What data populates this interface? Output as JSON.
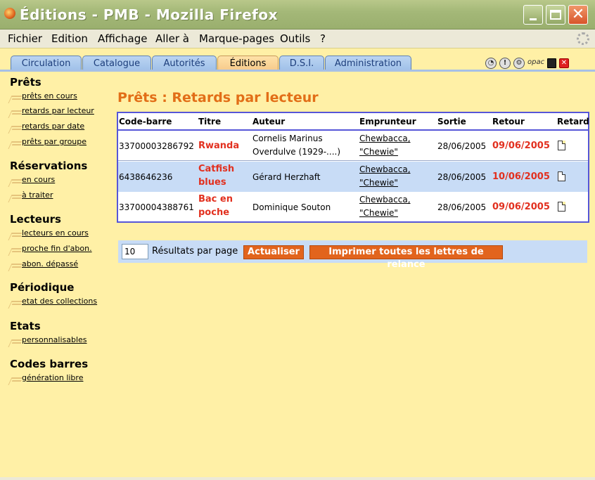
{
  "window": {
    "title": "Éditions - PMB - Mozilla Firefox"
  },
  "menubar": {
    "items": [
      {
        "label": "Fichier"
      },
      {
        "label": "Edition"
      },
      {
        "label": "Affichage"
      },
      {
        "label": "Aller à"
      },
      {
        "label": "Marque-pages"
      },
      {
        "label": "Outils"
      },
      {
        "label": "?"
      }
    ]
  },
  "tabs": [
    {
      "label": "Circulation"
    },
    {
      "label": "Catalogue"
    },
    {
      "label": "Autorités"
    },
    {
      "label": "Éditions",
      "active": true
    },
    {
      "label": "D.S.I."
    },
    {
      "label": "Administration"
    }
  ],
  "tab_icons": {
    "opac": "opac"
  },
  "sidebar": {
    "sections": [
      {
        "title": "Prêts",
        "links": [
          "prêts en cours",
          "retards par lecteur",
          "retards par date",
          "prêts par groupe"
        ]
      },
      {
        "title": "Réservations",
        "links": [
          "en cours",
          "à traiter"
        ]
      },
      {
        "title": "Lecteurs",
        "links": [
          "lecteurs en cours",
          "proche fin d'abon.",
          "abon. dépassé"
        ]
      },
      {
        "title": "Périodique",
        "links": [
          "etat des collections"
        ]
      },
      {
        "title": "Etats",
        "links": [
          "personnalisables"
        ]
      },
      {
        "title": "Codes barres",
        "links": [
          "génération libre"
        ]
      }
    ]
  },
  "main": {
    "title": "Prêts : Retards par lecteur",
    "table": {
      "headers": [
        "Code-barre",
        "Titre",
        "Auteur",
        "Emprunteur",
        "Sortie",
        "Retour",
        "Retard"
      ],
      "rows": [
        {
          "barcode": "33700003286792",
          "title_l1": "Rwanda",
          "title_l2": "",
          "author_l1": "Cornelis Marinus",
          "author_l2": "Overdulve (1929-....)",
          "borrower_l1": "Chewbacca,",
          "borrower_l2": "\"Chewie\"",
          "out": "28/06/2005",
          "due": "09/06/2005"
        },
        {
          "barcode": "6438646236",
          "title_l1": "Catfish",
          "title_l2": "blues",
          "author_l1": "Gérard Herzhaft",
          "author_l2": "",
          "borrower_l1": "Chewbacca,",
          "borrower_l2": "\"Chewie\"",
          "out": "28/06/2005",
          "due": "10/06/2005"
        },
        {
          "barcode": "33700004388761",
          "title_l1": "Bac en",
          "title_l2": "poche",
          "author_l1": "Dominique Souton",
          "author_l2": "",
          "borrower_l1": "Chewbacca,",
          "borrower_l2": "\"Chewie\"",
          "out": "28/06/2005",
          "due": "09/06/2005"
        }
      ]
    },
    "pager": {
      "results_value": "10",
      "results_label": "Résultats par page",
      "refresh_label": "Actualiser",
      "print_label": "Imprimer toutes les lettres de relance"
    }
  },
  "colors": {
    "accent": "#E26E17",
    "late_red": "#E2301F",
    "table_border": "#5656D8",
    "alt_row": "#C8DCF6",
    "page_bg": "#FFF0A6"
  }
}
